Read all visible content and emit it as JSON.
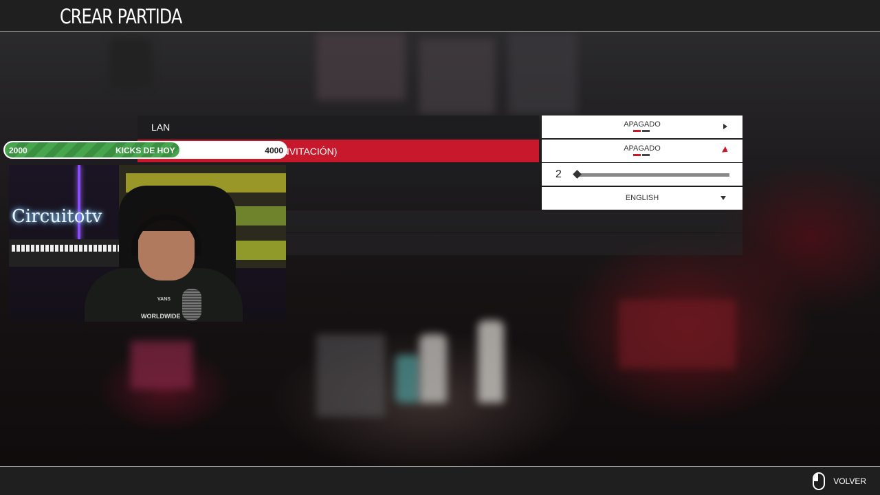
{
  "header": {
    "title": "CREAR PARTIDA"
  },
  "menu": {
    "rows": [
      {
        "label": "LAN",
        "value": "APAGADO",
        "active": false
      },
      {
        "label": "CHAT PRIVADA (SÓLO CON INVITACIÓN)",
        "value": "APAGADO",
        "active": true
      }
    ],
    "slider": {
      "value": "2",
      "level": 0.0
    },
    "language": {
      "value": "ENGLISH"
    }
  },
  "footer": {
    "back_label": "VOLVER"
  },
  "overlay": {
    "goal": {
      "start": "2000",
      "label": "KICKS DE HOY",
      "end": "4000",
      "progress": 0.62
    },
    "webcam": {
      "neon_sign": "Circuitotv",
      "shirt_text": "WORLDWIDE",
      "shirt_logo": "VANS"
    }
  },
  "colors": {
    "accent": "#c8192c",
    "bar_bg": "#1f1f1f",
    "goal_green": "#47a64d"
  }
}
